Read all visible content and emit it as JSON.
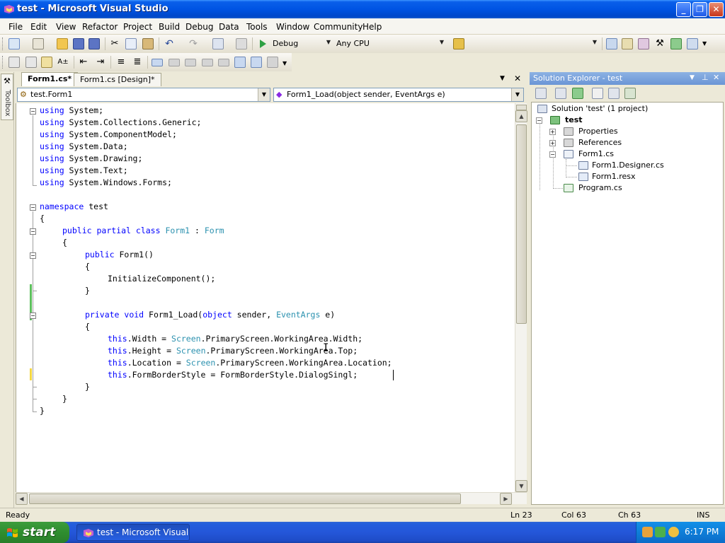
{
  "window": {
    "title": "test - Microsoft Visual Studio",
    "minimize_label": "_",
    "maximize_label": "❐",
    "close_label": "✕"
  },
  "menu": [
    "File",
    "Edit",
    "View",
    "Refactor",
    "Project",
    "Build",
    "Debug",
    "Data",
    "Tools",
    "Window",
    "Community",
    "Help"
  ],
  "toolbar": {
    "config": "Debug",
    "platform": "Any CPU",
    "find_value": ""
  },
  "toolbox": {
    "label": "Toolbox"
  },
  "tabs": [
    {
      "label": "Form1.cs*",
      "active": true
    },
    {
      "label": "Form1.cs [Design]*",
      "active": false
    }
  ],
  "editor": {
    "nav_type": "test.Form1",
    "nav_member": "Form1_Load(object sender, EventArgs e)",
    "tokens": {
      "using": "using",
      "namespace": "namespace",
      "public": "public",
      "partial": "partial",
      "class": "class",
      "private": "private",
      "void": "void",
      "object": "object",
      "this": "this"
    },
    "lines": {
      "l1": " System;",
      "l2": " System.Collections.Generic;",
      "l3": " System.ComponentModel;",
      "l4": " System.Data;",
      "l5": " System.Drawing;",
      "l6": " System.Text;",
      "l7": " System.Windows.Forms;",
      "l9": " test",
      "l10": "{",
      "l11_name": "Form1",
      "l11_colon": " : ",
      "l11_base": "Form",
      "l12": "{",
      "l13": " Form1()",
      "l14": "{",
      "l15": "InitializeComponent();",
      "l16": "}",
      "l18_sig": " Form1_Load(",
      "l18_sender": " sender, ",
      "l18_args": "EventArgs",
      "l18_end": " e)",
      "l19": "{",
      "l20_a": ".Width = ",
      "l20_b": ".PrimaryScreen.WorkingArea.Width;",
      "l21_a": ".Height = ",
      "l21_b": ".PrimaryScreen.WorkingArea.Top;",
      "l22_a": ".Location = ",
      "l22_b": ".PrimaryScreen.WorkingArea.Location;",
      "l23": ".FormBorderStyle = FormBorderStyle.DialogSingl;",
      "l24": "}",
      "l25": "}",
      "l26": "}",
      "screen": "Screen"
    }
  },
  "solution_explorer": {
    "title": "Solution Explorer - test",
    "items": {
      "solution": "Solution 'test' (1 project)",
      "project": "test",
      "properties": "Properties",
      "references": "References",
      "form1": "Form1.cs",
      "designer": "Form1.Designer.cs",
      "resx": "Form1.resx",
      "program": "Program.cs"
    }
  },
  "status": {
    "text": "Ready",
    "line": "Ln 23",
    "col": "Col 63",
    "ch": "Ch 63",
    "mode": "INS"
  },
  "taskbar": {
    "start": "start",
    "task": "test - Microsoft Visual...",
    "clock": "6:17 PM"
  },
  "colors": {
    "keyword": "#0000FF",
    "type": "#2B91AF",
    "change_saved": "#5DC05D",
    "change_unsaved": "#F5D843"
  }
}
